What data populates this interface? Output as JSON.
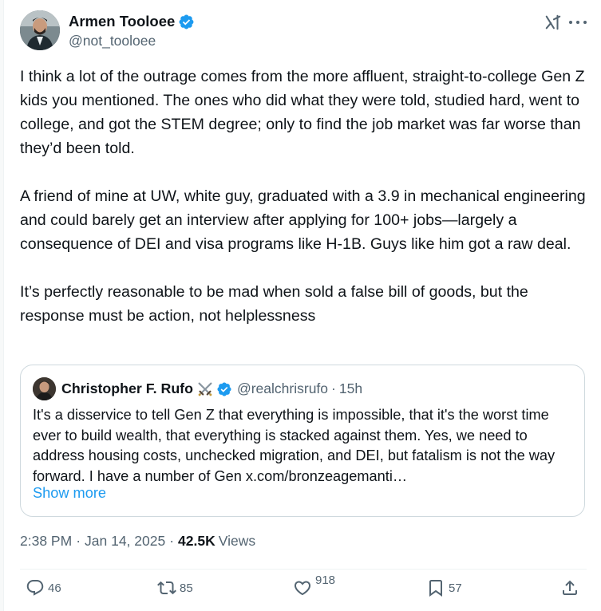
{
  "author": {
    "display_name": "Armen Tooloee",
    "handle": "@not_tooloee",
    "verified": true
  },
  "post": {
    "paragraphs": [
      "I think a lot of the outrage comes from the more affluent, straight-to-college Gen Z kids you mentioned. The ones who did what they were told, studied hard, went to college, and got the STEM degree; only to find the job market was far worse than they’d been told.",
      "A friend of mine at UW, white guy, graduated with a 3.9 in mechanical engineering and could barely get an interview after applying for 100+ jobs—largely a consequence of DEI and visa programs like H-1B. Guys like him got a raw deal.",
      "It’s perfectly reasonable to be mad when sold a false bill of goods, but the response must be action, not helplessness"
    ]
  },
  "quoted": {
    "display_name": "Christopher F. Rufo",
    "handle": "@realchrisrufo",
    "separator": "·",
    "time": "15h",
    "text": "It's a disservice to tell Gen Z that everything is impossible, that it's the worst time ever to build wealth, that everything is stacked against them. Yes, we need to address housing costs, unchecked migration, and DEI, but fatalism is not the way forward. I have a number of Gen x.com/bronzeagemanti…",
    "show_more": "Show more"
  },
  "meta": {
    "time": "2:38 PM",
    "date": "Jan 14, 2025",
    "separator": "·",
    "views_count": "42.5K",
    "views_label": "Views"
  },
  "actions": {
    "replies": "46",
    "reposts": "85",
    "likes": "918",
    "bookmarks": "57"
  },
  "icons": [
    "verified-badge-icon",
    "grok-icon",
    "more-icon",
    "crossed-swords-icon",
    "reply-icon",
    "retweet-icon",
    "like-icon",
    "bookmark-icon",
    "share-icon"
  ],
  "colors": {
    "accent": "#1d9bf0",
    "text": "#0f1419",
    "secondary": "#536471",
    "border": "#cfd9de"
  }
}
